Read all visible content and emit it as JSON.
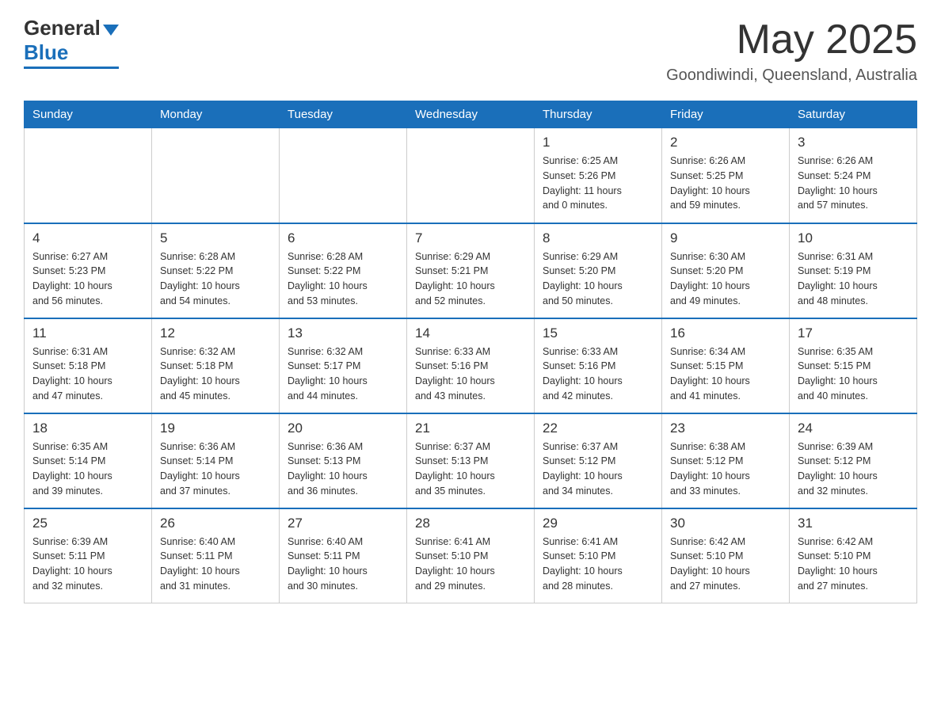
{
  "header": {
    "logo_general": "General",
    "logo_blue": "Blue",
    "month_year": "May 2025",
    "location": "Goondiwindi, Queensland, Australia"
  },
  "days_of_week": [
    "Sunday",
    "Monday",
    "Tuesday",
    "Wednesday",
    "Thursday",
    "Friday",
    "Saturday"
  ],
  "weeks": [
    [
      {
        "day": "",
        "info": ""
      },
      {
        "day": "",
        "info": ""
      },
      {
        "day": "",
        "info": ""
      },
      {
        "day": "",
        "info": ""
      },
      {
        "day": "1",
        "info": "Sunrise: 6:25 AM\nSunset: 5:26 PM\nDaylight: 11 hours\nand 0 minutes."
      },
      {
        "day": "2",
        "info": "Sunrise: 6:26 AM\nSunset: 5:25 PM\nDaylight: 10 hours\nand 59 minutes."
      },
      {
        "day": "3",
        "info": "Sunrise: 6:26 AM\nSunset: 5:24 PM\nDaylight: 10 hours\nand 57 minutes."
      }
    ],
    [
      {
        "day": "4",
        "info": "Sunrise: 6:27 AM\nSunset: 5:23 PM\nDaylight: 10 hours\nand 56 minutes."
      },
      {
        "day": "5",
        "info": "Sunrise: 6:28 AM\nSunset: 5:22 PM\nDaylight: 10 hours\nand 54 minutes."
      },
      {
        "day": "6",
        "info": "Sunrise: 6:28 AM\nSunset: 5:22 PM\nDaylight: 10 hours\nand 53 minutes."
      },
      {
        "day": "7",
        "info": "Sunrise: 6:29 AM\nSunset: 5:21 PM\nDaylight: 10 hours\nand 52 minutes."
      },
      {
        "day": "8",
        "info": "Sunrise: 6:29 AM\nSunset: 5:20 PM\nDaylight: 10 hours\nand 50 minutes."
      },
      {
        "day": "9",
        "info": "Sunrise: 6:30 AM\nSunset: 5:20 PM\nDaylight: 10 hours\nand 49 minutes."
      },
      {
        "day": "10",
        "info": "Sunrise: 6:31 AM\nSunset: 5:19 PM\nDaylight: 10 hours\nand 48 minutes."
      }
    ],
    [
      {
        "day": "11",
        "info": "Sunrise: 6:31 AM\nSunset: 5:18 PM\nDaylight: 10 hours\nand 47 minutes."
      },
      {
        "day": "12",
        "info": "Sunrise: 6:32 AM\nSunset: 5:18 PM\nDaylight: 10 hours\nand 45 minutes."
      },
      {
        "day": "13",
        "info": "Sunrise: 6:32 AM\nSunset: 5:17 PM\nDaylight: 10 hours\nand 44 minutes."
      },
      {
        "day": "14",
        "info": "Sunrise: 6:33 AM\nSunset: 5:16 PM\nDaylight: 10 hours\nand 43 minutes."
      },
      {
        "day": "15",
        "info": "Sunrise: 6:33 AM\nSunset: 5:16 PM\nDaylight: 10 hours\nand 42 minutes."
      },
      {
        "day": "16",
        "info": "Sunrise: 6:34 AM\nSunset: 5:15 PM\nDaylight: 10 hours\nand 41 minutes."
      },
      {
        "day": "17",
        "info": "Sunrise: 6:35 AM\nSunset: 5:15 PM\nDaylight: 10 hours\nand 40 minutes."
      }
    ],
    [
      {
        "day": "18",
        "info": "Sunrise: 6:35 AM\nSunset: 5:14 PM\nDaylight: 10 hours\nand 39 minutes."
      },
      {
        "day": "19",
        "info": "Sunrise: 6:36 AM\nSunset: 5:14 PM\nDaylight: 10 hours\nand 37 minutes."
      },
      {
        "day": "20",
        "info": "Sunrise: 6:36 AM\nSunset: 5:13 PM\nDaylight: 10 hours\nand 36 minutes."
      },
      {
        "day": "21",
        "info": "Sunrise: 6:37 AM\nSunset: 5:13 PM\nDaylight: 10 hours\nand 35 minutes."
      },
      {
        "day": "22",
        "info": "Sunrise: 6:37 AM\nSunset: 5:12 PM\nDaylight: 10 hours\nand 34 minutes."
      },
      {
        "day": "23",
        "info": "Sunrise: 6:38 AM\nSunset: 5:12 PM\nDaylight: 10 hours\nand 33 minutes."
      },
      {
        "day": "24",
        "info": "Sunrise: 6:39 AM\nSunset: 5:12 PM\nDaylight: 10 hours\nand 32 minutes."
      }
    ],
    [
      {
        "day": "25",
        "info": "Sunrise: 6:39 AM\nSunset: 5:11 PM\nDaylight: 10 hours\nand 32 minutes."
      },
      {
        "day": "26",
        "info": "Sunrise: 6:40 AM\nSunset: 5:11 PM\nDaylight: 10 hours\nand 31 minutes."
      },
      {
        "day": "27",
        "info": "Sunrise: 6:40 AM\nSunset: 5:11 PM\nDaylight: 10 hours\nand 30 minutes."
      },
      {
        "day": "28",
        "info": "Sunrise: 6:41 AM\nSunset: 5:10 PM\nDaylight: 10 hours\nand 29 minutes."
      },
      {
        "day": "29",
        "info": "Sunrise: 6:41 AM\nSunset: 5:10 PM\nDaylight: 10 hours\nand 28 minutes."
      },
      {
        "day": "30",
        "info": "Sunrise: 6:42 AM\nSunset: 5:10 PM\nDaylight: 10 hours\nand 27 minutes."
      },
      {
        "day": "31",
        "info": "Sunrise: 6:42 AM\nSunset: 5:10 PM\nDaylight: 10 hours\nand 27 minutes."
      }
    ]
  ]
}
